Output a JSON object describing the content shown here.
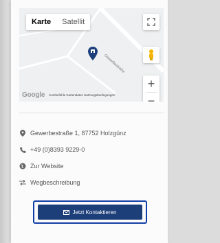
{
  "map": {
    "type_buttons": [
      "Karte",
      "Satellit"
    ],
    "street_label": "Gewerbestraße",
    "google_label": "Google",
    "footer_links": "Kurzbefehle   Kartendaten   Nutzungsbedingungen",
    "zoom_in": "+",
    "zoom_out": "−"
  },
  "contact": {
    "address": "Gewerbestraße 1, 87752 Holzgünz",
    "phone": "+49 (0)8393 9229-0",
    "website": "Zur Website",
    "directions": "Wegbeschreibung"
  },
  "cta": {
    "label": "Jetzt Kontaktieren"
  },
  "colors": {
    "cta_bg": "#1c3f7a",
    "cta_border": "#123ea8",
    "pin": "#1c3f7a"
  }
}
